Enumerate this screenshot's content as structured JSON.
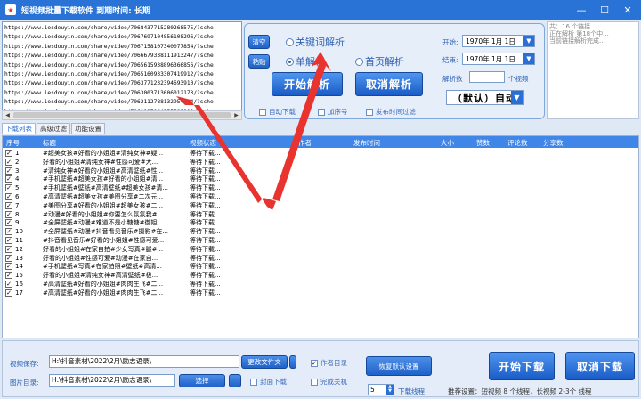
{
  "app": {
    "title": "短视频批量下载软件  到期时间: 长期",
    "icon": "app-logo-icon"
  },
  "window_buttons": [
    "—",
    "☐",
    "✕"
  ],
  "url_list": [
    "https://www.iesdouyin.com/share/video/7068437715280268575/?sche",
    "https://www.iesdouyin.com/share/video/7067697104856108296/?sche",
    "https://www.iesdouyin.com/share/video/7067158107340077854/?sche",
    "https://www.iesdouyin.com/share/video/7066679338111913247/?sche",
    "https://www.iesdouyin.com/share/video/7065615938896366856/?sche",
    "https://www.iesdouyin.com/share/video/7065160933307419912/?sche",
    "https://www.iesdouyin.com/share/video/7063771232394693910/?sche",
    "https://www.iesdouyin.com/share/video/7063003713606012173/?sche",
    "https://www.iesdouyin.com/share/video/7062112788132954484/?sche",
    "https://www.iesdouyin.com/share/video/7061127044255599909/?sche"
  ],
  "controls": {
    "clear_label": "清空",
    "paste_label": "粘贴",
    "keyword_radio": "关键词解析",
    "single_radio": "单解析",
    "home_radio": "首页解析",
    "start_parse": "开始解析",
    "cancel_parse": "取消解析",
    "start_label": "开始:",
    "end_label": "结束:",
    "start_date": "1970年 1月 1日",
    "end_date": "1970年 1月 1日",
    "parse_count_label": "解析数",
    "parse_count_unit": "个视频",
    "mode_combo": "（默认）自动",
    "auto_download": "自动下载",
    "add_number": "加序号",
    "publish_filter": "发布时间过滤"
  },
  "log": {
    "lines": [
      "共：16 个链接",
      "正在解析 第18个中...",
      "当前链接解析完成..."
    ]
  },
  "tabs": [
    "下载列表",
    "高级过滤",
    "功能设置"
  ],
  "table": {
    "headers": [
      "序号",
      "标题",
      "视频状态",
      "作者",
      "发布时间",
      "大小",
      "赞数",
      "评论数",
      "分享数"
    ],
    "rows": [
      {
        "n": "1",
        "title": "#超美女孩#好看的小姐姐#清纯女神#疑...",
        "status": "等待下载..."
      },
      {
        "n": "2",
        "title": "好看的小姐姐#清纯女神#性感可爱#大...",
        "status": "等待下载..."
      },
      {
        "n": "3",
        "title": "#清纯女神#好看的小姐姐#高清壁纸#性...",
        "status": "等待下载..."
      },
      {
        "n": "4",
        "title": "#手机壁纸#超美女孩#好看的小姐姐#清...",
        "status": "等待下载..."
      },
      {
        "n": "5",
        "title": "#手机壁纸#壁纸#高清壁纸#超美女孩#清...",
        "status": "等待下载..."
      },
      {
        "n": "6",
        "title": "#高清壁纸#超美女孩#美图分享#二次元...",
        "status": "等待下载..."
      },
      {
        "n": "7",
        "title": "#美图分享#好看的小姐姐#超美女孩#二...",
        "status": "等待下载..."
      },
      {
        "n": "8",
        "title": "#动漫#好看的小姐姐#你要怎么氛氛我#...",
        "status": "等待下载..."
      },
      {
        "n": "9",
        "title": "#全屏壁纸#动漫#难道不是小糖糖#御姐...",
        "status": "等待下载..."
      },
      {
        "n": "10",
        "title": "#全屏壁纸#动漫#抖音看见音乐#摄影#在...",
        "status": "等待下载..."
      },
      {
        "n": "11",
        "title": "#抖音看见音乐#好看的小姐姐#性感可爱...",
        "status": "等待下载..."
      },
      {
        "n": "12",
        "title": "好看的小姐姐#在家自拍#少女写真#腿#...",
        "status": "等待下载..."
      },
      {
        "n": "13",
        "title": "好看的小姐姐#性感可爱#动漫#在家自...",
        "status": "等待下载..."
      },
      {
        "n": "14",
        "title": "#手机壁纸#写真#在家拍照#壁纸#高清...",
        "status": "等待下载..."
      },
      {
        "n": "15",
        "title": "好看的小姐姐#清纯女神#高清壁纸#极...",
        "status": "等待下载..."
      },
      {
        "n": "16",
        "title": "#高清壁纸#好看的小姐姐#肉肉生飞#二...",
        "status": "等待下载..."
      },
      {
        "n": "17",
        "title": "#高清壁纸#好看的小姐姐#肉肉生飞#二...",
        "status": "等待下载..."
      }
    ]
  },
  "bottom": {
    "save_label": "视频保存:",
    "save_path": "H:\\抖音素材\\2022\\2月\\励志语录\\",
    "change_folder": "更改文件夹",
    "author_dir": "作者目录",
    "image_label": "图片目录:",
    "image_path": "H:\\抖音素材\\2022\\2月\\励志语录\\",
    "select_label": "选择",
    "cover_download": "封面下载",
    "finish_shutdown": "完成关机",
    "restore_defaults": "恢复默认设置",
    "threads_value": "5",
    "threads_label": "下载线程",
    "recommend": "推荐设置：短视频 8 个线程，长视频 2-3个 线程",
    "start_download": "开始下载",
    "cancel_download": "取消下载"
  },
  "colors": {
    "title_bar": "#2a73d6",
    "accent_blue": "#1f62c9",
    "arrow_red": "#e8332f",
    "table_header": "#3f86e8"
  }
}
